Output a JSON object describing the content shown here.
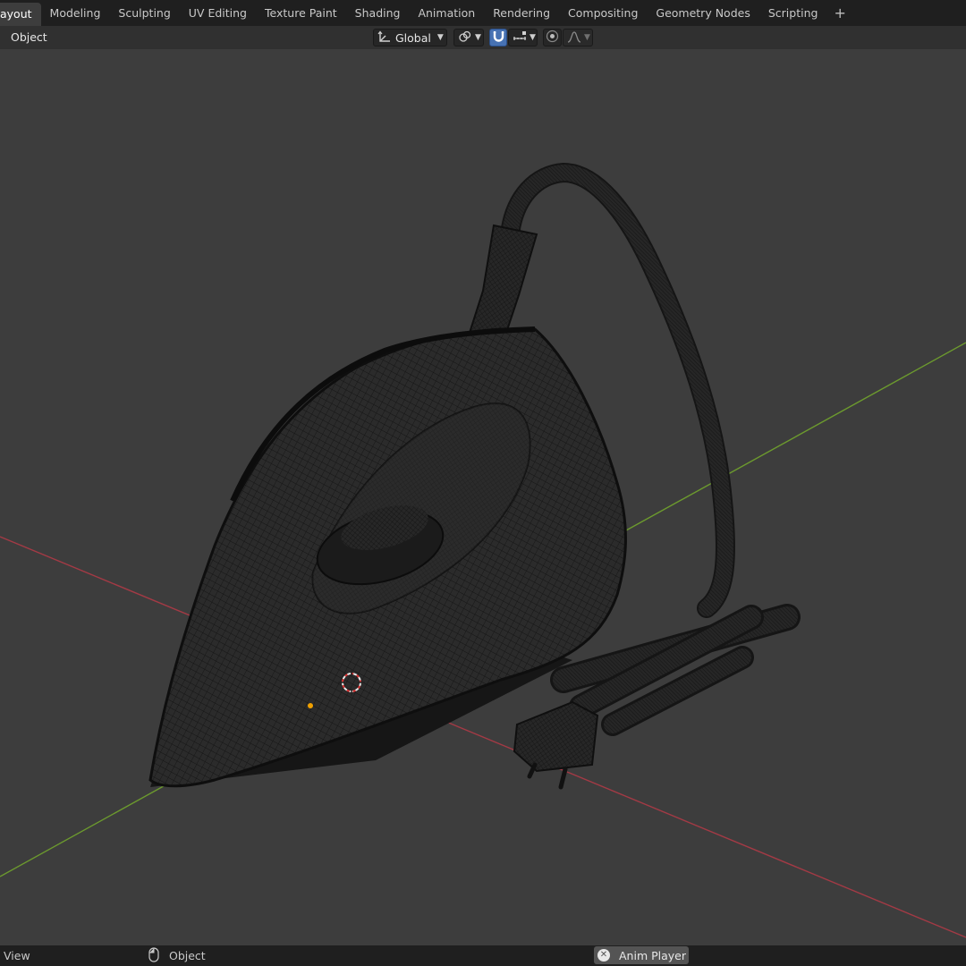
{
  "workspace_tabs": [
    {
      "label": "Layout",
      "visible_label": "ayout",
      "active": true
    },
    {
      "label": "Modeling"
    },
    {
      "label": "Sculpting"
    },
    {
      "label": "UV Editing"
    },
    {
      "label": "Texture Paint"
    },
    {
      "label": "Shading"
    },
    {
      "label": "Animation"
    },
    {
      "label": "Rendering"
    },
    {
      "label": "Compositing"
    },
    {
      "label": "Geometry Nodes"
    },
    {
      "label": "Scripting"
    }
  ],
  "add_workspace": "+",
  "header": {
    "object_menu": "Object",
    "transform_orientation": "Global",
    "pivot_icon": "link-circles-icon",
    "snap_icon": "magnet-icon",
    "snap_target_icon": "snap-increment-icon",
    "proportional_icon": "proportional-edit-icon",
    "falloff_icon": "falloff-curve-icon"
  },
  "statusbar": {
    "left_label": "View",
    "mouse_icon": "mouse-icon",
    "middle_label": "Object",
    "anim_player": "Anim Player"
  },
  "colors": {
    "x_axis": "#a33a45",
    "y_axis": "#6c9a2e",
    "active_tab_bg": "#3d3d3d",
    "snap_active": "#4772b3",
    "origin_dot": "#f0a000"
  }
}
